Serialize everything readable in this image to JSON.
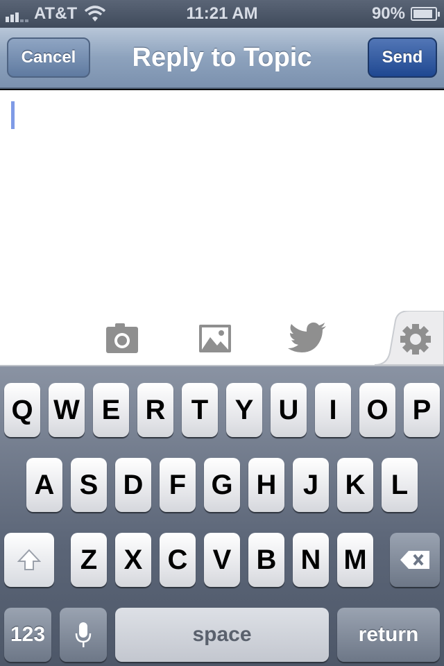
{
  "status_bar": {
    "carrier": "AT&T",
    "time": "11:21 AM",
    "battery": "90%",
    "battery_level": 0.9
  },
  "nav": {
    "cancel_label": "Cancel",
    "title": "Reply to Topic",
    "send_label": "Send"
  },
  "compose": {
    "text": ""
  },
  "toolbar": {
    "icons": [
      "camera-icon",
      "image-icon",
      "twitter-icon",
      "gear-icon"
    ]
  },
  "keyboard": {
    "row1": [
      "Q",
      "W",
      "E",
      "R",
      "T",
      "Y",
      "U",
      "I",
      "O",
      "P"
    ],
    "row2": [
      "A",
      "S",
      "D",
      "F",
      "G",
      "H",
      "J",
      "K",
      "L"
    ],
    "row3": [
      "Z",
      "X",
      "C",
      "V",
      "B",
      "N",
      "M"
    ],
    "numbers_label": "123",
    "space_label": "space",
    "return_label": "return"
  },
  "colors": {
    "nav_accent": "#7b91ae",
    "send_button": "#1f4891",
    "caret": "#7f9be6"
  }
}
